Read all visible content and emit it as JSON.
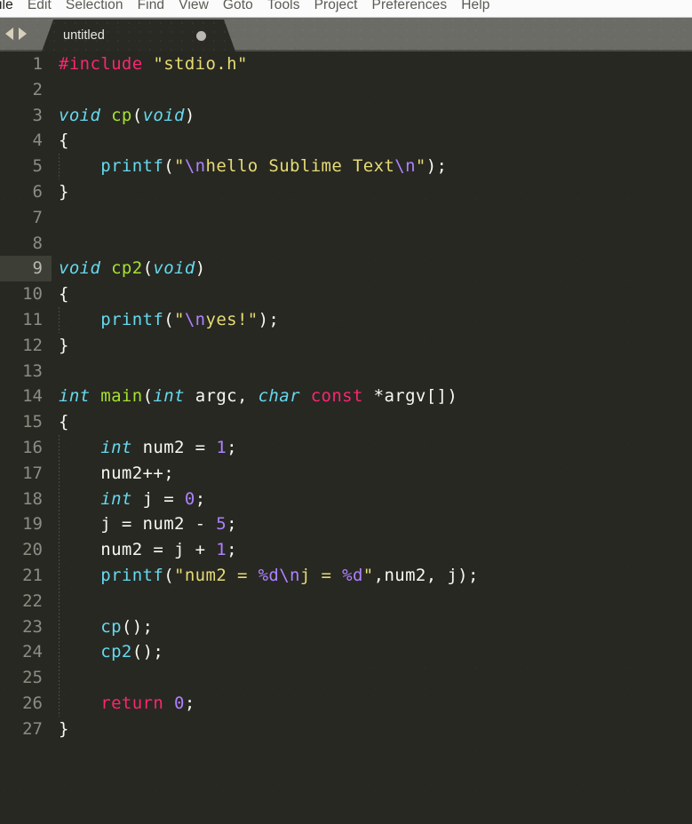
{
  "app": {
    "name": "Sublime Text",
    "theme": "Monokai",
    "colors": {
      "editor_bg": "#272822",
      "tabbar_bg": "#6c6c66",
      "tab_active_bg": "#2a2a24",
      "menubar_bg": "#fbfbfb",
      "gutter_text": "#8c8c82",
      "gutter_active_bg": "#3d3e36",
      "foreground": "#f8f8f2",
      "keyword": "#66d9ef",
      "preprocessor": "#f92672",
      "string": "#e6db74",
      "function": "#a6e22e",
      "number": "#ae81ff"
    }
  },
  "menubar": {
    "items": [
      {
        "label": "ile"
      },
      {
        "label": "Edit"
      },
      {
        "label": "Selection"
      },
      {
        "label": "Find"
      },
      {
        "label": "View"
      },
      {
        "label": "Goto"
      },
      {
        "label": "Tools"
      },
      {
        "label": "Project"
      },
      {
        "label": "Preferences"
      },
      {
        "label": "Help"
      }
    ]
  },
  "tabbar": {
    "nav_back_icon": "triangle-left-icon",
    "nav_forward_icon": "triangle-right-icon",
    "tabs": [
      {
        "label": "untitled",
        "active": true,
        "dirty": true,
        "dirty_icon": "unsaved-dot-icon"
      }
    ]
  },
  "editor": {
    "active_line": 9,
    "language": "C",
    "total_lines": 27,
    "lines": [
      {
        "n": 1,
        "tokens": [
          {
            "t": "#include",
            "c": "t-pre"
          },
          {
            "t": " ",
            "c": "t-plain"
          },
          {
            "t": "\"stdio.h\"",
            "c": "t-str"
          }
        ]
      },
      {
        "n": 2,
        "tokens": []
      },
      {
        "n": 3,
        "tokens": [
          {
            "t": "void",
            "c": "t-kw"
          },
          {
            "t": " ",
            "c": "t-plain"
          },
          {
            "t": "cp",
            "c": "t-fn"
          },
          {
            "t": "(",
            "c": "t-punct"
          },
          {
            "t": "void",
            "c": "t-kw"
          },
          {
            "t": ")",
            "c": "t-punct"
          }
        ]
      },
      {
        "n": 4,
        "tokens": [
          {
            "t": "{",
            "c": "t-punct"
          }
        ]
      },
      {
        "n": 5,
        "tokens": [
          {
            "t": "    ",
            "c": "t-plain"
          },
          {
            "t": "printf",
            "c": "t-call"
          },
          {
            "t": "(",
            "c": "t-punct"
          },
          {
            "t": "\"",
            "c": "t-str"
          },
          {
            "t": "\\n",
            "c": "t-esc"
          },
          {
            "t": "hello Sublime Text",
            "c": "t-str"
          },
          {
            "t": "\\n",
            "c": "t-esc"
          },
          {
            "t": "\"",
            "c": "t-str"
          },
          {
            "t": ");",
            "c": "t-punct"
          }
        ]
      },
      {
        "n": 6,
        "tokens": [
          {
            "t": "}",
            "c": "t-punct"
          }
        ]
      },
      {
        "n": 7,
        "tokens": []
      },
      {
        "n": 8,
        "tokens": []
      },
      {
        "n": 9,
        "tokens": [
          {
            "t": "void",
            "c": "t-kw"
          },
          {
            "t": " ",
            "c": "t-plain"
          },
          {
            "t": "cp2",
            "c": "t-fn"
          },
          {
            "t": "(",
            "c": "t-punct"
          },
          {
            "t": "void",
            "c": "t-kw"
          },
          {
            "t": ")",
            "c": "t-punct"
          }
        ]
      },
      {
        "n": 10,
        "tokens": [
          {
            "t": "{",
            "c": "t-punct"
          }
        ]
      },
      {
        "n": 11,
        "tokens": [
          {
            "t": "    ",
            "c": "t-plain"
          },
          {
            "t": "printf",
            "c": "t-call"
          },
          {
            "t": "(",
            "c": "t-punct"
          },
          {
            "t": "\"",
            "c": "t-str"
          },
          {
            "t": "\\n",
            "c": "t-esc"
          },
          {
            "t": "yes!",
            "c": "t-str"
          },
          {
            "t": "\"",
            "c": "t-str"
          },
          {
            "t": ");",
            "c": "t-punct"
          }
        ]
      },
      {
        "n": 12,
        "tokens": [
          {
            "t": "}",
            "c": "t-punct"
          }
        ]
      },
      {
        "n": 13,
        "tokens": []
      },
      {
        "n": 14,
        "tokens": [
          {
            "t": "int",
            "c": "t-kw"
          },
          {
            "t": " ",
            "c": "t-plain"
          },
          {
            "t": "main",
            "c": "t-fn"
          },
          {
            "t": "(",
            "c": "t-punct"
          },
          {
            "t": "int",
            "c": "t-kw"
          },
          {
            "t": " argc, ",
            "c": "t-plain"
          },
          {
            "t": "char",
            "c": "t-kw"
          },
          {
            "t": " ",
            "c": "t-plain"
          },
          {
            "t": "const",
            "c": "t-pre"
          },
          {
            "t": " *argv[])",
            "c": "t-plain"
          }
        ]
      },
      {
        "n": 15,
        "tokens": [
          {
            "t": "{",
            "c": "t-punct"
          }
        ]
      },
      {
        "n": 16,
        "tokens": [
          {
            "t": "    ",
            "c": "t-plain"
          },
          {
            "t": "int",
            "c": "t-kw"
          },
          {
            "t": " num2 = ",
            "c": "t-plain"
          },
          {
            "t": "1",
            "c": "t-num"
          },
          {
            "t": ";",
            "c": "t-punct"
          }
        ]
      },
      {
        "n": 17,
        "tokens": [
          {
            "t": "    num2++;",
            "c": "t-plain"
          }
        ]
      },
      {
        "n": 18,
        "tokens": [
          {
            "t": "    ",
            "c": "t-plain"
          },
          {
            "t": "int",
            "c": "t-kw"
          },
          {
            "t": " j = ",
            "c": "t-plain"
          },
          {
            "t": "0",
            "c": "t-num"
          },
          {
            "t": ";",
            "c": "t-punct"
          }
        ]
      },
      {
        "n": 19,
        "tokens": [
          {
            "t": "    j = num2 - ",
            "c": "t-plain"
          },
          {
            "t": "5",
            "c": "t-num"
          },
          {
            "t": ";",
            "c": "t-punct"
          }
        ]
      },
      {
        "n": 20,
        "tokens": [
          {
            "t": "    num2 = j + ",
            "c": "t-plain"
          },
          {
            "t": "1",
            "c": "t-num"
          },
          {
            "t": ";",
            "c": "t-punct"
          }
        ]
      },
      {
        "n": 21,
        "tokens": [
          {
            "t": "    ",
            "c": "t-plain"
          },
          {
            "t": "printf",
            "c": "t-call"
          },
          {
            "t": "(",
            "c": "t-punct"
          },
          {
            "t": "\"",
            "c": "t-str"
          },
          {
            "t": "num2 = ",
            "c": "t-str"
          },
          {
            "t": "%d",
            "c": "t-esc"
          },
          {
            "t": "\\n",
            "c": "t-esc"
          },
          {
            "t": "j = ",
            "c": "t-str"
          },
          {
            "t": "%d",
            "c": "t-esc"
          },
          {
            "t": "\"",
            "c": "t-str"
          },
          {
            "t": ",num2, j);",
            "c": "t-plain"
          }
        ]
      },
      {
        "n": 22,
        "tokens": []
      },
      {
        "n": 23,
        "tokens": [
          {
            "t": "    ",
            "c": "t-plain"
          },
          {
            "t": "cp",
            "c": "t-call"
          },
          {
            "t": "();",
            "c": "t-punct"
          }
        ]
      },
      {
        "n": 24,
        "tokens": [
          {
            "t": "    ",
            "c": "t-plain"
          },
          {
            "t": "cp2",
            "c": "t-call"
          },
          {
            "t": "();",
            "c": "t-punct"
          }
        ]
      },
      {
        "n": 25,
        "tokens": []
      },
      {
        "n": 26,
        "tokens": [
          {
            "t": "    ",
            "c": "t-plain"
          },
          {
            "t": "return",
            "c": "t-pre"
          },
          {
            "t": " ",
            "c": "t-plain"
          },
          {
            "t": "0",
            "c": "t-num"
          },
          {
            "t": ";",
            "c": "t-punct"
          }
        ]
      },
      {
        "n": 27,
        "tokens": [
          {
            "t": "}",
            "c": "t-punct"
          }
        ]
      }
    ],
    "indent_guides": [
      {
        "line_start": 5,
        "line_end": 5,
        "col": 0
      },
      {
        "line_start": 11,
        "line_end": 11,
        "col": 0
      },
      {
        "line_start": 16,
        "line_end": 26,
        "col": 0
      }
    ]
  }
}
